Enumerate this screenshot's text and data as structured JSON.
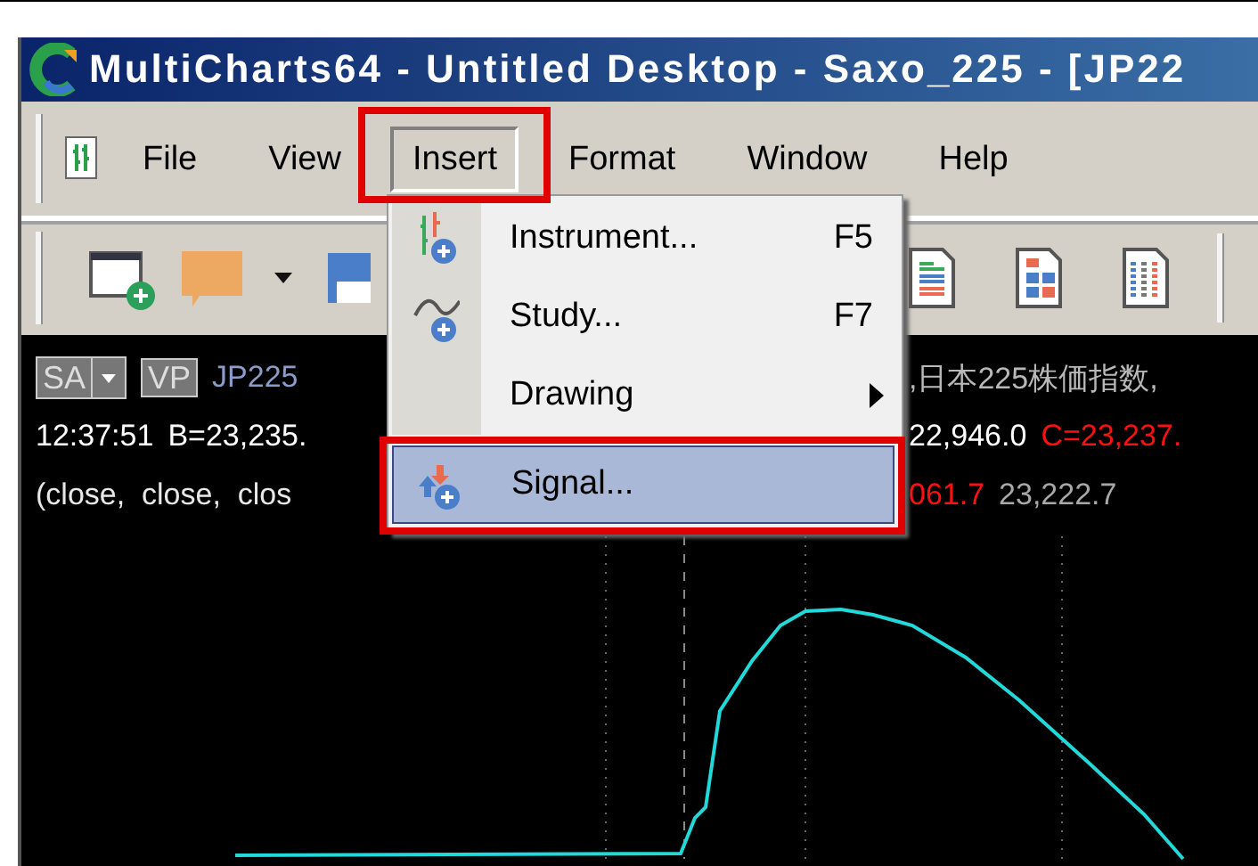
{
  "window": {
    "title": "MultiCharts64 - Untitled Desktop - Saxo_225 - [JP22"
  },
  "menu_bar": [
    {
      "label": "File",
      "selected": false
    },
    {
      "label": "View",
      "selected": false
    },
    {
      "label": "Insert",
      "selected": true,
      "annotated": true
    },
    {
      "label": "Format",
      "selected": false
    },
    {
      "label": "Window",
      "selected": false
    },
    {
      "label": "Help",
      "selected": false
    }
  ],
  "toolbar": [
    {
      "kind": "new-window"
    },
    {
      "kind": "note"
    },
    {
      "kind": "dropdown"
    },
    {
      "kind": "save"
    },
    {
      "kind": "gap"
    },
    {
      "kind": "doc-lines"
    },
    {
      "kind": "doc-blocks"
    },
    {
      "kind": "doc-grid"
    }
  ],
  "insert_menu": [
    {
      "kind": "instrument",
      "label": "Instrument...",
      "shortcut": "F5",
      "selected": false
    },
    {
      "kind": "study",
      "label": "Study...",
      "shortcut": "F7",
      "selected": false
    },
    {
      "kind": "submenu",
      "label": "Drawing",
      "selected": false
    },
    {
      "kind": "signal",
      "label": "Signal...",
      "selected": true,
      "annotated": true
    }
  ],
  "chart": {
    "mode": "SA",
    "badge": "VP",
    "lines": [
      {
        "left": [
          {
            "text": "JP225",
            "color": "#8c9cc8"
          }
        ],
        "right": [
          {
            "text": ",日本225株価指数,",
            "color": "#b8b8b8"
          }
        ]
      },
      {
        "left": [
          {
            "text": "12:37:51",
            "color": "#ffffff"
          },
          {
            "text": "B=23,235.",
            "color": "#ffffff"
          }
        ],
        "right": [
          {
            "text": "22,946.0",
            "color": "#ffffff"
          },
          {
            "text": "C=23,237.",
            "color": "#ff1010"
          }
        ]
      },
      {
        "left": [
          {
            "text": "(close,  close,  clos",
            "color": "#e8e8e8"
          }
        ],
        "right": [
          {
            "text": "061.7",
            "color": "#ff1010"
          },
          {
            "text": "23,222.7",
            "color": "#a8a8a8"
          }
        ]
      }
    ]
  }
}
